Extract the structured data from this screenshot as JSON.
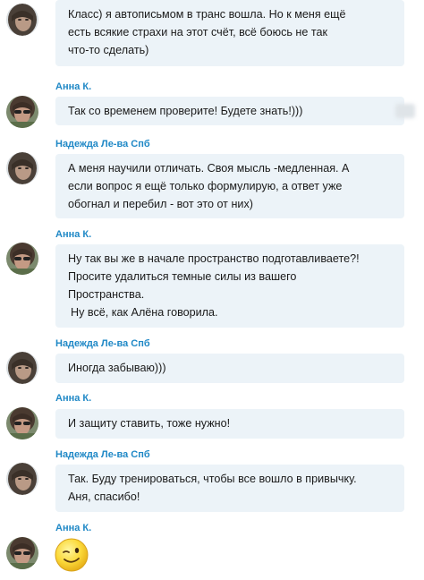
{
  "messages": [
    {
      "sender": "",
      "lines": [
        "Класс) я автописьмом в транс вошла. Но к меня ещё",
        "есть всякие страхи на этот счёт, всё боюсь не так",
        "что-то сделать)"
      ]
    },
    {
      "sender": "Анна К.",
      "lines": [
        "Так со временем проверите! Будете знать!)))"
      ]
    },
    {
      "sender": "Надежда Ле-ва Спб",
      "lines": [
        "А меня научили отличать. Своя мысль -медленная. А",
        "если вопрос я ещё только формулирую, а ответ уже",
        "обогнал и перебил - вот это от них)"
      ]
    },
    {
      "sender": "Анна К.",
      "lines": [
        "Ну так вы же в начале пространство подготавливаете?!",
        "Просите удалиться темные силы из вашего",
        "Пространства.",
        " Ну всё, как Алёна говорила."
      ]
    },
    {
      "sender": "Надежда Ле-ва Спб",
      "lines": [
        "Иногда забываю)))"
      ]
    },
    {
      "sender": "Анна К.",
      "lines": [
        "И защиту ставить, тоже нужно!"
      ]
    },
    {
      "sender": "Надежда Ле-ва Спб",
      "lines": [
        "Так. Буду тренироваться, чтобы все вошло в привычку.",
        "Аня, спасибо!"
      ]
    },
    {
      "sender": "Анна К.",
      "emoji": "winking-face-emoji"
    }
  ],
  "colors": {
    "sender_name": "#1f88c6",
    "bubble_bg": "#ecf3f8",
    "text": "#1a1a1a"
  }
}
